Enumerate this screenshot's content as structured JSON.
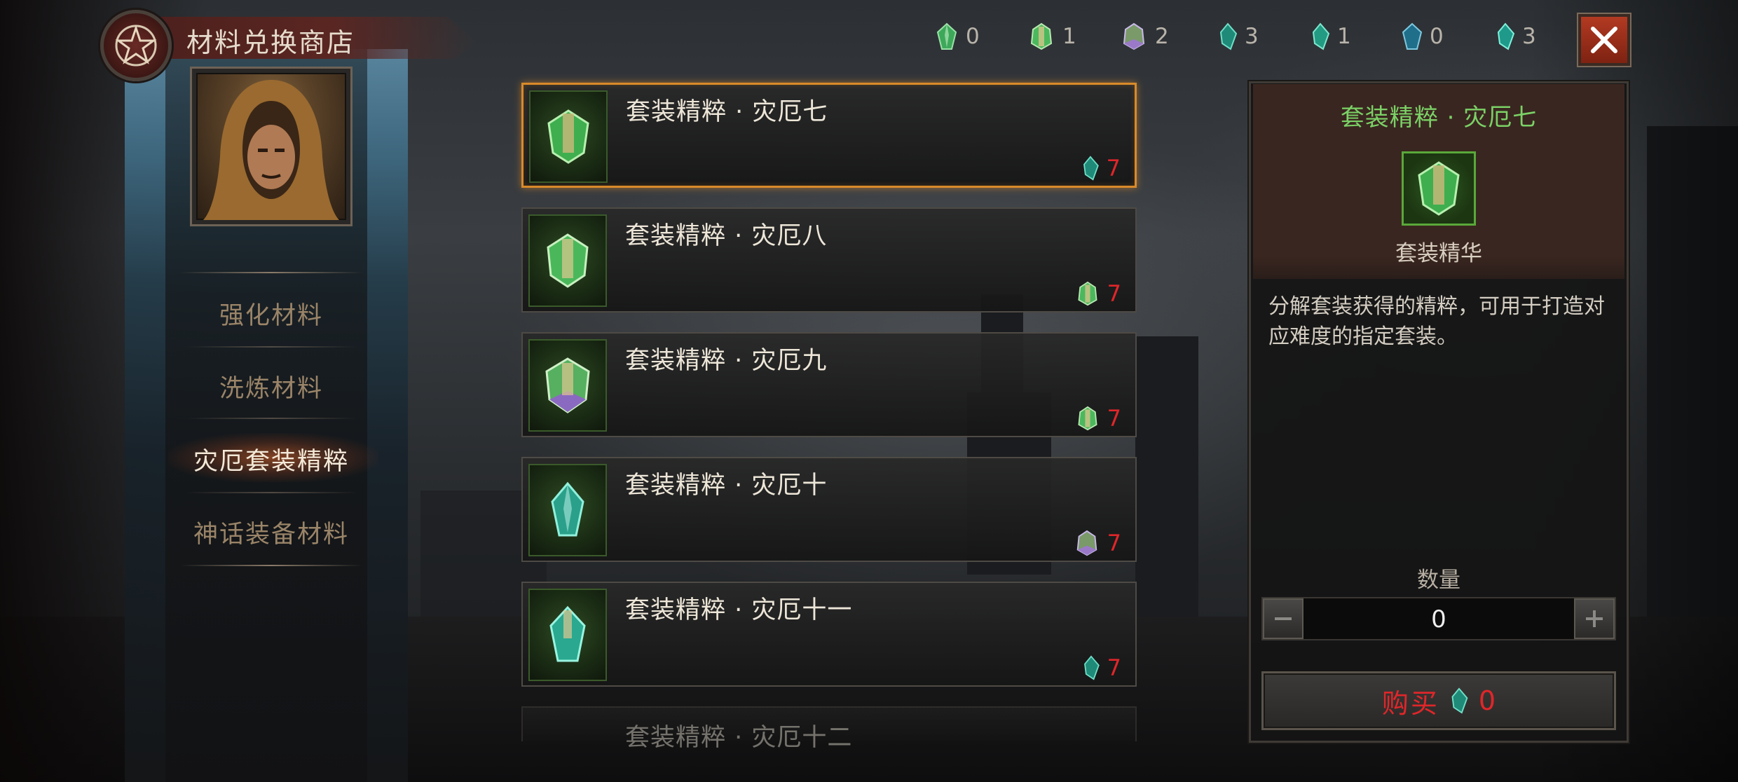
{
  "shop": {
    "title": "材料兑换商店",
    "close_icon": "close-icon"
  },
  "currencies": [
    {
      "icon": "green-crystal-icon",
      "color": "#4ec26a",
      "count": "0"
    },
    {
      "icon": "green-crystal-cluster-icon",
      "color": "#5ac470",
      "count": "1"
    },
    {
      "icon": "purple-green-crystal-icon",
      "color": "#9a7ac8",
      "count": "2"
    },
    {
      "icon": "teal-shard-icon",
      "color": "#2fb8a0",
      "count": "3"
    },
    {
      "icon": "teal-shard-small-icon",
      "color": "#35c0a5",
      "count": "1"
    },
    {
      "icon": "blue-shard-icon",
      "color": "#2f9ab8",
      "count": "0"
    },
    {
      "icon": "cyan-shard-icon",
      "color": "#30c4b0",
      "count": "3"
    }
  ],
  "sidebar": {
    "items": [
      {
        "label": "强化材料",
        "active": false
      },
      {
        "label": "洗炼材料",
        "active": false
      },
      {
        "label": "灾厄套装精粹",
        "active": true
      },
      {
        "label": "神话装备材料",
        "active": false
      }
    ]
  },
  "items": [
    {
      "name": "套装精粹 · 灾厄七",
      "price": "7",
      "price_icon": "teal-shard-icon",
      "selected": true
    },
    {
      "name": "套装精粹 · 灾厄八",
      "price": "7",
      "price_icon": "green-crystal-cluster-icon",
      "selected": false
    },
    {
      "name": "套装精粹 · 灾厄九",
      "price": "7",
      "price_icon": "green-crystal-cluster-icon",
      "selected": false
    },
    {
      "name": "套装精粹 · 灾厄十",
      "price": "7",
      "price_icon": "purple-green-crystal-icon",
      "selected": false
    },
    {
      "name": "套装精粹 · 灾厄十一",
      "price": "7",
      "price_icon": "teal-shard-icon",
      "selected": false
    },
    {
      "name": "套装精粹 · 灾厄十二",
      "price": "",
      "price_icon": "",
      "selected": false
    }
  ],
  "detail": {
    "title": "套装精粹 · 灾厄七",
    "subtitle": "套装精华",
    "description": "分解套装获得的精粹，可用于打造对应难度的指定套装。",
    "quantity_label": "数量",
    "quantity": "0",
    "buy_label": "购买",
    "buy_amount": "0"
  },
  "colors": {
    "accent_orange": "#d98a2a",
    "price_red": "#e0262a",
    "detail_title_green": "#7bd166"
  }
}
